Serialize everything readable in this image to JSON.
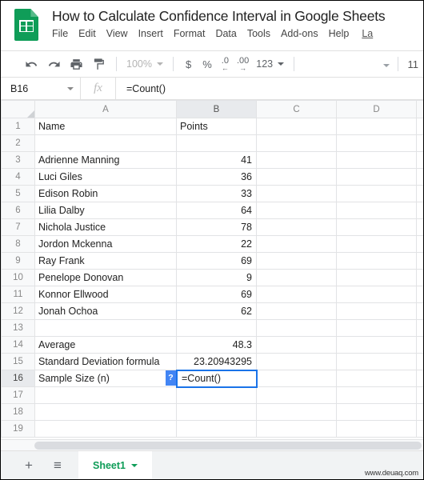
{
  "header": {
    "logo_icon": "google-sheets-logo",
    "doc_title": "How to Calculate Confidence Interval in Google Sheets",
    "menu": [
      "File",
      "Edit",
      "View",
      "Insert",
      "Format",
      "Data",
      "Tools",
      "Add-ons",
      "Help"
    ],
    "last_edit_truncated": "La"
  },
  "toolbar": {
    "undo_icon": "undo-icon",
    "redo_icon": "redo-icon",
    "print_icon": "print-icon",
    "paint_format_icon": "paint-format-icon",
    "zoom_value": "100%",
    "currency_label": "$",
    "percent_label": "%",
    "decrease_decimal_label": ".0",
    "increase_decimal_label": ".00",
    "more_formats_label": "123",
    "font_size": "11"
  },
  "formula_bar": {
    "name_box": "B16",
    "fx_label": "fx",
    "formula_value": "=Count()"
  },
  "grid": {
    "columns": [
      "A",
      "B",
      "C",
      "D"
    ],
    "active_column": "B",
    "active_row": 16,
    "rows": [
      {
        "n": "1",
        "A": "Name",
        "B": "Points",
        "B_num": false
      },
      {
        "n": "2",
        "A": "",
        "B": "",
        "B_num": false
      },
      {
        "n": "3",
        "A": "Adrienne Manning",
        "B": "41",
        "B_num": true
      },
      {
        "n": "4",
        "A": "Luci Giles",
        "B": "36",
        "B_num": true
      },
      {
        "n": "5",
        "A": "Edison Robin",
        "B": "33",
        "B_num": true
      },
      {
        "n": "6",
        "A": "Lilia Dalby",
        "B": "64",
        "B_num": true
      },
      {
        "n": "7",
        "A": "Nichola Justice",
        "B": "78",
        "B_num": true
      },
      {
        "n": "8",
        "A": "Jordon Mckenna",
        "B": "22",
        "B_num": true
      },
      {
        "n": "9",
        "A": "Ray Frank",
        "B": "69",
        "B_num": true
      },
      {
        "n": "10",
        "A": "Penelope Donovan",
        "B": "9",
        "B_num": true
      },
      {
        "n": "11",
        "A": "Konnor Ellwood",
        "B": "69",
        "B_num": true
      },
      {
        "n": "12",
        "A": "Jonah Ochoa",
        "B": "62",
        "B_num": true
      },
      {
        "n": "13",
        "A": "",
        "B": "",
        "B_num": false
      },
      {
        "n": "14",
        "A": "Average",
        "B": "48.3",
        "B_num": true
      },
      {
        "n": "15",
        "A": "Standard Deviation formula",
        "B": "23.20943295",
        "B_num": true
      },
      {
        "n": "16",
        "A": "Sample Size (n)",
        "B": "",
        "B_num": false
      },
      {
        "n": "17",
        "A": "",
        "B": "",
        "B_num": false
      },
      {
        "n": "18",
        "A": "",
        "B": "",
        "B_num": false
      },
      {
        "n": "19",
        "A": "",
        "B": "",
        "B_num": false
      }
    ],
    "cell_editor": {
      "value": "=Count()",
      "help_badge": "?",
      "border_color": "#1a73e8",
      "badge_color": "#4285F4"
    },
    "annotation": {
      "arrow_icon": "red-left-arrow",
      "color": "#E8140A"
    }
  },
  "bottom_bar": {
    "add_sheet_label": "+",
    "all_sheets_label": "≡",
    "sheet_tab_name": "Sheet1",
    "watermark": "www.deuaq.com"
  }
}
